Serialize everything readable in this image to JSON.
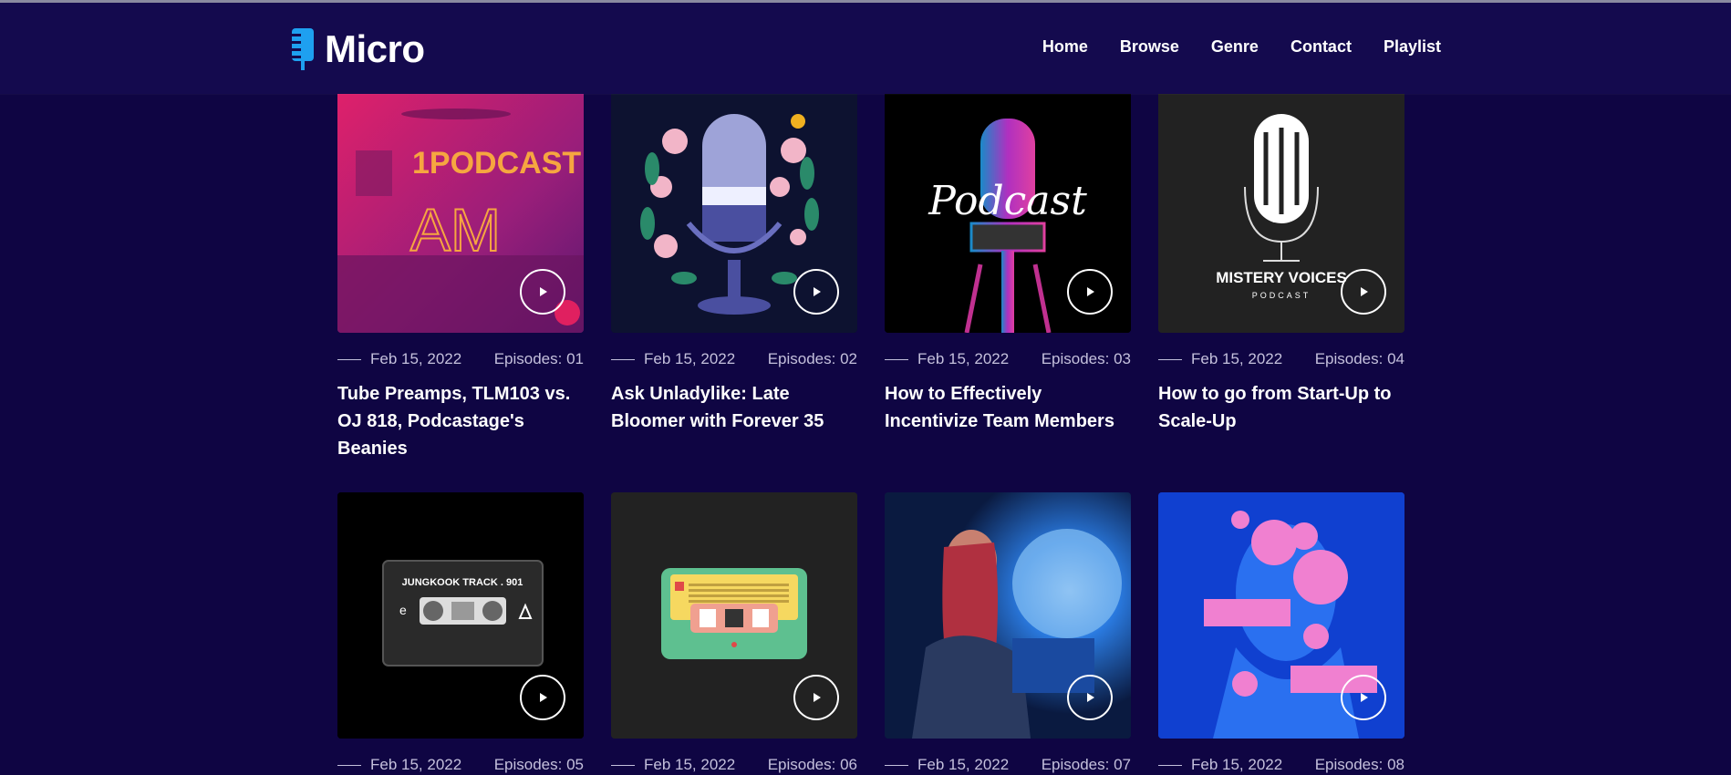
{
  "brand": {
    "name": "Micro"
  },
  "nav": {
    "items": [
      {
        "label": "Home"
      },
      {
        "label": "Browse"
      },
      {
        "label": "Genre"
      },
      {
        "label": "Contact"
      },
      {
        "label": "Playlist"
      }
    ]
  },
  "podcasts": [
    {
      "date": "Feb 15, 2022",
      "episodes": "Episodes: 01",
      "title": "Tube Preamps, TLM103 vs. OJ 818, Podcastage's Beanies",
      "art_text_1": "1PODCAST",
      "art_text_2": "AM"
    },
    {
      "date": "Feb 15, 2022",
      "episodes": "Episodes: 02",
      "title": "Ask Unladylike: Late Bloomer with Forever 35"
    },
    {
      "date": "Feb 15, 2022",
      "episodes": "Episodes: 03",
      "title": "How to Effectively Incentivize Team Members",
      "art_text_1": "Podcast"
    },
    {
      "date": "Feb 15, 2022",
      "episodes": "Episodes: 04",
      "title": "How to go from Start-Up to Scale-Up",
      "art_text_1": "MISTERY VOICES",
      "art_text_2": "PODCAST"
    },
    {
      "date": "Feb 15, 2022",
      "episodes": "Episodes: 05",
      "title": "",
      "art_text_1": "JUNGKOOK TRACK . 901"
    },
    {
      "date": "Feb 15, 2022",
      "episodes": "Episodes: 06",
      "title": ""
    },
    {
      "date": "Feb 15, 2022",
      "episodes": "Episodes: 07",
      "title": ""
    },
    {
      "date": "Feb 15, 2022",
      "episodes": "Episodes: 08",
      "title": ""
    }
  ],
  "colors": {
    "page_bg": "#0f0543",
    "header_bg": "#140a4e",
    "logo_accent": "#1ea0f0",
    "meta_text": "#c4c0dc"
  }
}
